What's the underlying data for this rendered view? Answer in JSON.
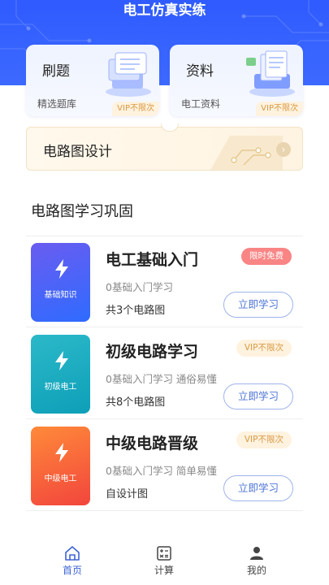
{
  "header": {
    "title": "电工仿真实练"
  },
  "cards": [
    {
      "title": "刷题",
      "subtitle": "精选题库",
      "tag": "VIP不限次",
      "icon": "question-bank-illustration"
    },
    {
      "title": "资料",
      "subtitle": "电工资料",
      "tag": "VIP不限次",
      "icon": "documents-illustration"
    }
  ],
  "banner": {
    "title": "电路图设计",
    "icon": "chevron-right-icon"
  },
  "section": {
    "title": "电路图学习巩固"
  },
  "courses": [
    {
      "cover_label": "基础知识",
      "title": "电工基础入门",
      "desc": "0基础入门学习",
      "count": "共3个电路图",
      "badge": "限时免费",
      "button": "立即学习",
      "cover_colors": [
        "#6a5cf0",
        "#2f6bff"
      ],
      "badge_color": "#f98585"
    },
    {
      "cover_label": "初级电工",
      "title": "初级电路学习",
      "desc": "0基础入门学习 通俗易懂",
      "count": "共8个电路图",
      "badge": "VIP不限次",
      "button": "立即学习",
      "cover_colors": [
        "#2bb9c9",
        "#0e9fb8"
      ]
    },
    {
      "cover_label": "中级电工",
      "title": "中级电路晋级",
      "desc": "0基础入门学习 简单易懂",
      "count": "自设计图",
      "badge": "VIP不限次",
      "button": "立即学习",
      "cover_colors": [
        "#ff8a3a",
        "#f2453c"
      ]
    }
  ],
  "tabbar": {
    "tabs": [
      {
        "label": "首页",
        "icon": "home-icon",
        "active": true
      },
      {
        "label": "计算",
        "icon": "calculator-icon",
        "active": false
      },
      {
        "label": "我的",
        "icon": "user-icon",
        "active": false
      }
    ]
  },
  "colors": {
    "primary": "#3e64d6",
    "header": "#2f5bff",
    "vip_text": "#d99a43",
    "vip_bg": "#fff2df"
  }
}
